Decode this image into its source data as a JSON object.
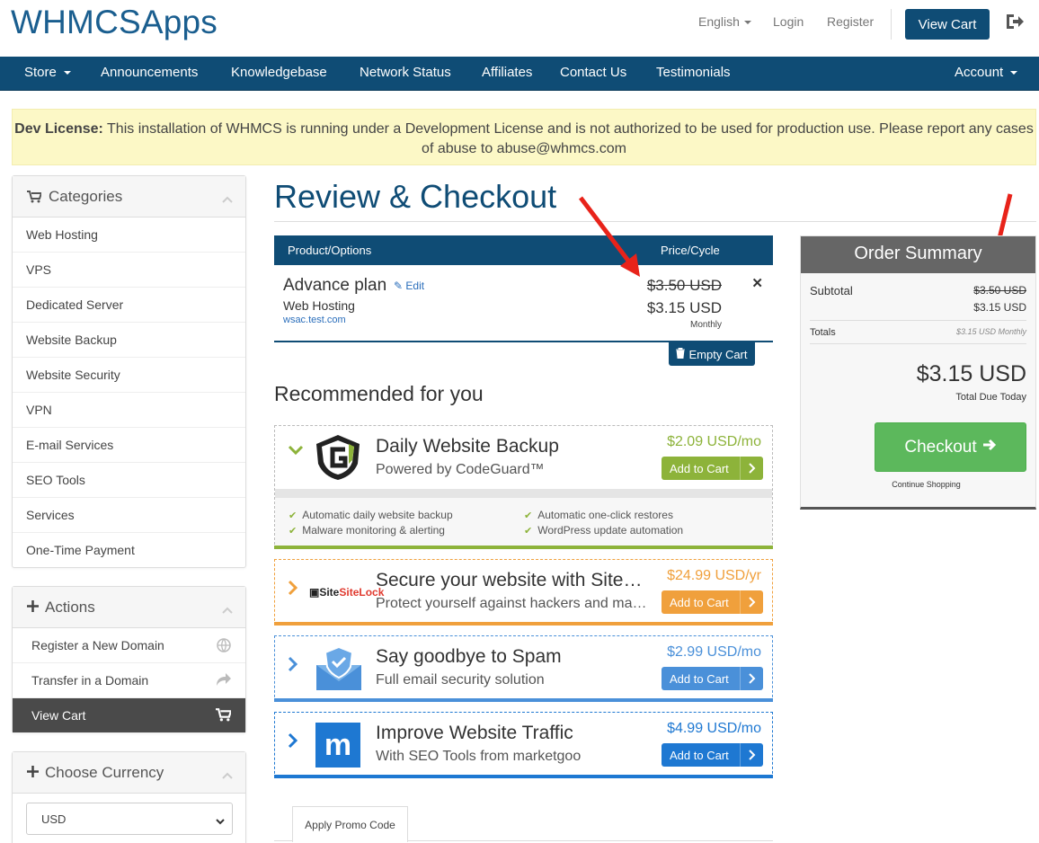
{
  "header": {
    "logo": "WHMCSApps",
    "language": "English",
    "login": "Login",
    "register": "Register",
    "view_cart": "View Cart"
  },
  "nav": {
    "store": "Store",
    "items": [
      "Announcements",
      "Knowledgebase",
      "Network Status",
      "Affiliates",
      "Contact Us",
      "Testimonials"
    ],
    "account": "Account"
  },
  "alert": {
    "bold": "Dev License:",
    "text": " This installation of WHMCS is running under a Development License and is not authorized to be used for production use. Please report any cases of abuse to abuse@whmcs.com"
  },
  "sidebar": {
    "categories": {
      "title": "Categories",
      "items": [
        "Web Hosting",
        "VPS",
        "Dedicated Server",
        "Website Backup",
        "Website Security",
        "VPN",
        "E-mail Services",
        "SEO Tools",
        "Services",
        "One-Time Payment"
      ]
    },
    "actions": {
      "title": "Actions",
      "items": [
        "Register a New Domain",
        "Transfer in a Domain",
        "View Cart"
      ]
    },
    "currency": {
      "title": "Choose Currency",
      "selected": "USD"
    }
  },
  "page": {
    "title": "Review & Checkout"
  },
  "cart": {
    "col_product": "Product/Options",
    "col_price": "Price/Cycle",
    "item": {
      "name": "Advance plan",
      "edit": "Edit",
      "group": "Web Hosting",
      "domain": "wsac.test.com",
      "old_price": "$3.50 USD",
      "price": "$3.15 USD",
      "cycle": "Monthly"
    },
    "empty": "Empty Cart"
  },
  "recommended": {
    "title": "Recommended for you",
    "items": [
      {
        "title": "Daily Website Backup",
        "sub": "Powered by CodeGuard™",
        "price": "$2.09 USD/mo",
        "btn": "Add to Cart",
        "color": "#8db33a"
      },
      {
        "title": "Secure your website with SiteLock",
        "sub": "Protect yourself against hackers and malware",
        "price": "$24.99 USD/yr",
        "btn": "Add to Cart",
        "color": "#f0a03c",
        "logo": "SiteLock"
      },
      {
        "title": "Say goodbye to Spam",
        "sub": "Full email security solution",
        "price": "$2.99 USD/mo",
        "btn": "Add to Cart",
        "color": "#4a90d9"
      },
      {
        "title": "Improve Website Traffic",
        "sub": "With SEO Tools from marketgoo",
        "price": "$4.99 USD/mo",
        "btn": "Add to Cart",
        "color": "#1e78d2",
        "logo": "m"
      }
    ],
    "features": [
      "Automatic daily website backup",
      "Malware monitoring & alerting",
      "Automatic one-click restores",
      "WordPress update automation"
    ]
  },
  "promo": {
    "tab": "Apply Promo Code"
  },
  "summary": {
    "title": "Order Summary",
    "subtotal_label": "Subtotal",
    "subtotal_old": "$3.50 USD",
    "subtotal": "$3.15 USD",
    "totals_label": "Totals",
    "totals_value": "$3.15 USD Monthly",
    "total": "$3.15 USD",
    "total_due": "Total Due Today",
    "checkout": "Checkout",
    "continue": "Continue Shopping"
  }
}
